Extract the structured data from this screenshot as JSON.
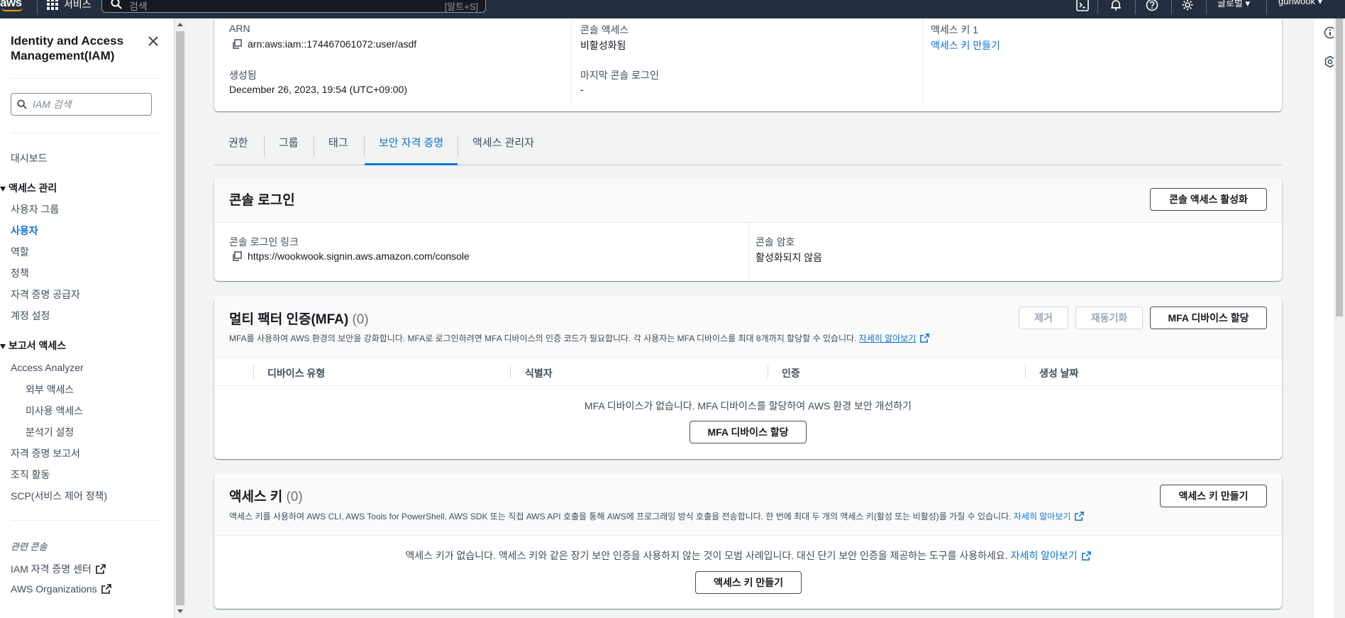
{
  "topbar": {
    "logo": "aws",
    "services_label": "서비스",
    "search_placeholder": "검색",
    "search_shortcut": "[알트+S]",
    "region_label": "글로벌",
    "user_label": "gunwook"
  },
  "sidebar": {
    "title": "Identity and Access Management(IAM)",
    "search_placeholder": "IAM 검색",
    "dashboard": "대시보드",
    "access_management": "액세스 관리",
    "user_groups": "사용자 그룹",
    "users": "사용자",
    "roles": "역할",
    "policies": "정책",
    "identity_providers": "자격 증명 공급자",
    "account_settings": "계정 설정",
    "access_reports": "보고서 액세스",
    "access_analyzer": "Access Analyzer",
    "external_access": "외부 액세스",
    "unused_access": "미사용 액세스",
    "analyzer_settings": "분석기 설정",
    "credential_report": "자격 증명 보고서",
    "org_activity": "조직 활동",
    "scp": "SCP(서비스 제어 정책)",
    "related_consoles": "관련 콘솔",
    "iam_identity_center": "IAM 자격 증명 센터",
    "aws_organizations": "AWS Organizations"
  },
  "summary": {
    "arn_label": "ARN",
    "arn_value": "arn:aws:iam::174467061072:user/asdf",
    "created_label": "생성됨",
    "created_value": "December 26, 2023, 19:54 (UTC+09:00)",
    "console_access_label": "콘솔 액세스",
    "console_access_value": "비활성화됨",
    "last_login_label": "마지막 콘솔 로그인",
    "last_login_value": "-",
    "access_key_label": "액세스 키 1",
    "access_key_link": "액세스 키 만들기"
  },
  "tabs": [
    "권한",
    "그룹",
    "태그",
    "보안 자격 증명",
    "액세스 관리자"
  ],
  "console_signin": {
    "title": "콘솔 로그인",
    "enable_button": "콘솔 액세스 활성화",
    "link_label": "콘솔 로그인 링크",
    "link_value": "https://wookwook.signin.aws.amazon.com/console",
    "password_label": "콘솔 암호",
    "password_value": "활성화되지 않음"
  },
  "mfa": {
    "title": "멀티 팩터 인증(MFA)",
    "count": "(0)",
    "remove_button": "제거",
    "resync_button": "재동기화",
    "assign_button": "MFA 디바이스 할당",
    "description": "MFA를 사용하여 AWS 환경의 보안을 강화합니다. MFA로 로그인하려면 MFA 디바이스의 인증 코드가 필요합니다. 각 사용자는 MFA 디바이스를 최대 8개까지 할당할 수 있습니다.",
    "learn_more": "자세히 알아보기",
    "columns": [
      "디바이스 유형",
      "식별자",
      "인증",
      "생성 날짜"
    ],
    "empty_text": "MFA 디바이스가 없습니다. MFA 디바이스를 할당하여 AWS 환경 보안 개선하기",
    "empty_button": "MFA 디바이스 할당"
  },
  "access_keys": {
    "title": "액세스 키",
    "count": "(0)",
    "create_button": "액세스 키 만들기",
    "description": "액세스 키를 사용하여 AWS CLI, AWS Tools for PowerShell, AWS SDK 또는 직접 AWS API 호출을 통해 AWS에 프로그래밍 방식 호출을 전송합니다. 한 번에 최대 두 개의 액세스 키(활성 또는 비활성)를 가질 수 있습니다.",
    "learn_more": "자세히 알아보기",
    "empty_text": "액세스 키가 없습니다. 액세스 키와 같은 장기 보안 인증을 사용하지 않는 것이 모범 사례입니다. 대신 단기 보안 인증을 제공하는 도구를 사용하세요.",
    "empty_learn_more": "자세히 알아보기",
    "empty_button": "액세스 키 만들기"
  },
  "colors": {
    "accent": "#0972d3",
    "header_bg": "#232f3e",
    "brand_orange": "#ff9900"
  }
}
